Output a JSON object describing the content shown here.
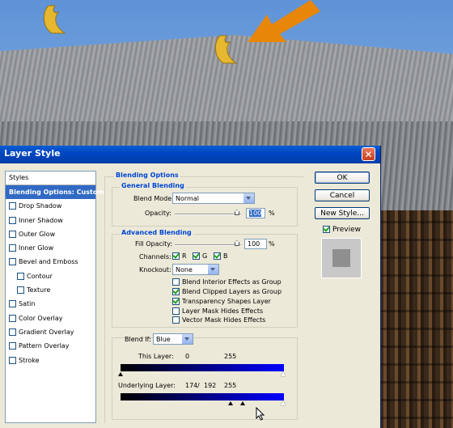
{
  "dialog": {
    "title": "Layer Style",
    "close_glyph": "✕"
  },
  "styles_panel": {
    "header": "Styles",
    "items": [
      {
        "label": "Blending Options: Custom",
        "selected": true,
        "checkbox": false
      },
      {
        "label": "Drop Shadow",
        "checkbox": true
      },
      {
        "label": "Inner Shadow",
        "checkbox": true
      },
      {
        "label": "Outer Glow",
        "checkbox": true
      },
      {
        "label": "Inner Glow",
        "checkbox": true
      },
      {
        "label": "Bevel and Emboss",
        "checkbox": true
      },
      {
        "label": "Contour",
        "checkbox": true,
        "sub": true
      },
      {
        "label": "Texture",
        "checkbox": true,
        "sub": true
      },
      {
        "label": "Satin",
        "checkbox": true
      },
      {
        "label": "Color Overlay",
        "checkbox": true
      },
      {
        "label": "Gradient Overlay",
        "checkbox": true
      },
      {
        "label": "Pattern Overlay",
        "checkbox": true
      },
      {
        "label": "Stroke",
        "checkbox": true
      }
    ]
  },
  "blending": {
    "section_title": "Blending Options",
    "general": {
      "title": "General Blending",
      "blend_mode_label": "Blend Mode:",
      "blend_mode_value": "Normal",
      "opacity_label": "Opacity:",
      "opacity_value": "100",
      "opacity_unit": "%"
    },
    "advanced": {
      "title": "Advanced Blending",
      "fill_opacity_label": "Fill Opacity:",
      "fill_opacity_value": "100",
      "fill_opacity_unit": "%",
      "channels_label": "Channels:",
      "channels": [
        "R",
        "G",
        "B"
      ],
      "knockout_label": "Knockout:",
      "knockout_value": "None",
      "options": [
        {
          "label": "Blend Interior Effects as Group",
          "checked": false
        },
        {
          "label": "Blend Clipped Layers as Group",
          "checked": true
        },
        {
          "label": "Transparency Shapes Layer",
          "checked": true
        },
        {
          "label": "Layer Mask Hides Effects",
          "checked": false
        },
        {
          "label": "Vector Mask Hides Effects",
          "checked": false
        }
      ]
    },
    "blend_if": {
      "label": "Blend If:",
      "value": "Blue",
      "this_layer_label": "This Layer:",
      "this_layer_low": "0",
      "this_layer_high": "255",
      "underlying_label": "Underlying Layer:",
      "underlying_low": "174",
      "underlying_sep": "/",
      "underlying_mid": "192",
      "underlying_high": "255"
    }
  },
  "buttons": {
    "ok": "OK",
    "cancel": "Cancel",
    "new_style": "New Style...",
    "preview_label": "Preview"
  },
  "colors": {
    "titlebar": "#0047c2",
    "selection": "#316ac5",
    "arrow": "#e8860a",
    "blend_gradient_end": "#0000ff"
  }
}
